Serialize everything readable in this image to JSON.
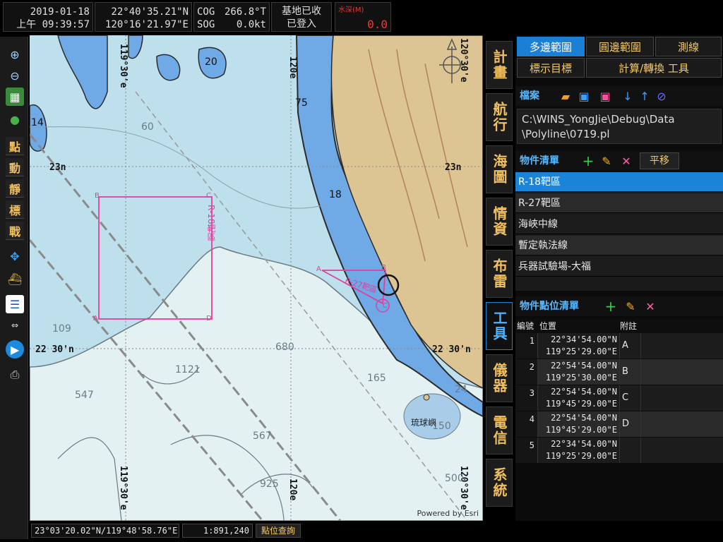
{
  "topbar": {
    "date": "2019-01-18",
    "time": "上午 09:39:57",
    "lat": "22°40'35.21\"N",
    "lon": "120°16'21.97\"E",
    "cog_label": "COG",
    "cog_value": "266.8°T",
    "sog_label": "SOG",
    "sog_value": "0.0kt",
    "base_status_1": "基地已收",
    "base_status_2": "已登入",
    "depth_label": "水深(M)",
    "depth_value": "0.0"
  },
  "left_toolbar": {
    "labels": [
      "點",
      "動",
      "靜",
      "標",
      "戰"
    ]
  },
  "map": {
    "grid_labels": {
      "top_lon_left": "119°30'e",
      "top_lon_mid": "120e",
      "top_lon_right": "120°30'e",
      "bottom_lon_left": "119°30'e",
      "bottom_lon_mid": "120e",
      "bottom_lon_right": "120°30'e",
      "lat_23_left": "23n",
      "lat_23_right": "23n",
      "lat_2230_left": "22 30'n",
      "lat_2230_right": "22 30'n"
    },
    "depths": [
      "20",
      "14",
      "60",
      "75",
      "18",
      "109",
      "680",
      "1121",
      "547",
      "165",
      "24",
      "150",
      "567",
      "925",
      "500"
    ],
    "place_label": "琉球嶼",
    "polygon_label": "R-18靶區",
    "polygon_vertices": [
      "B",
      "C",
      "A",
      "D"
    ],
    "r27_label": "R-27靶區",
    "r27_vertices": [
      "A",
      "B",
      "C"
    ],
    "attribution": "Powered by Esri"
  },
  "statusbar": {
    "cursor_pos": "23°03'20.02\"N/119°48'58.76\"E",
    "scale": "1:891,240",
    "query_button": "點位查詢"
  },
  "vtabs": [
    "計畫",
    "航行",
    "海圖",
    "情資",
    "布雷",
    "工具",
    "儀器",
    "電信",
    "系統"
  ],
  "vtab_active": "工具",
  "panel": {
    "tabs_row1": [
      "多邊範圍",
      "圓邊範圍",
      "測線"
    ],
    "tabs_row2": [
      "標示目標",
      "計算/轉換 工具"
    ],
    "active_tab": "多邊範圍",
    "file_header": "檔案",
    "file_path_1": "C:\\WINS_YongJie\\Debug\\Data",
    "file_path_2": "\\Polyline\\0719.pl",
    "obj_header": "物件清單",
    "pan_button": "平移",
    "objects": [
      "R-18靶區",
      "R-27靶區",
      "海峽中線",
      "暫定執法線",
      "兵器試驗場-大福"
    ],
    "selected_object": "R-18靶區",
    "pt_header": "物件點位清單",
    "col_no": "編號",
    "col_pos": "位置",
    "col_note": "附註",
    "points": [
      {
        "no": "1",
        "lat": "22°34'54.00\"N",
        "lon": "119°25'29.00\"E",
        "note": "A"
      },
      {
        "no": "2",
        "lat": "22°54'54.00\"N",
        "lon": "119°25'30.00\"E",
        "note": "B"
      },
      {
        "no": "3",
        "lat": "22°54'54.00\"N",
        "lon": "119°45'29.00\"E",
        "note": "C"
      },
      {
        "no": "4",
        "lat": "22°54'54.00\"N",
        "lon": "119°45'29.00\"E",
        "note": "D"
      },
      {
        "no": "5",
        "lat": "22°34'54.00\"N",
        "lon": "119°25'29.00\"E",
        "note": ""
      }
    ]
  }
}
